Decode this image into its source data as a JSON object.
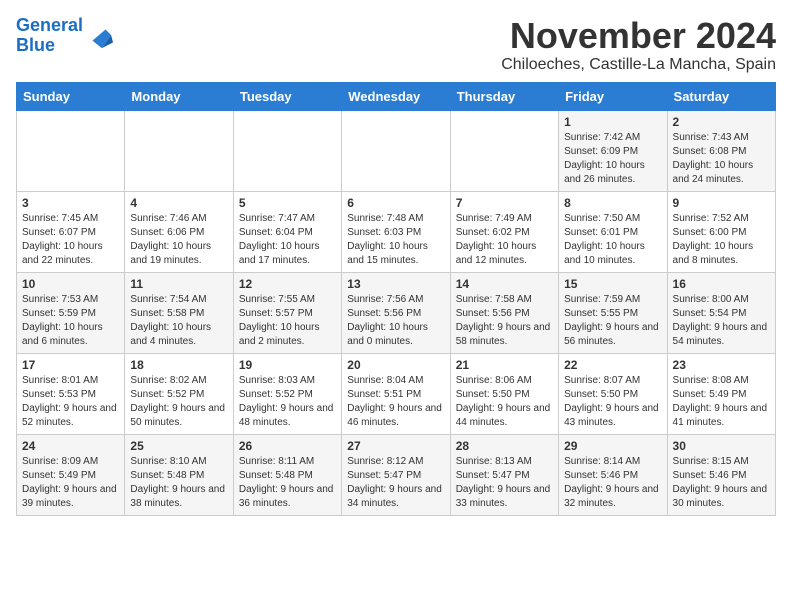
{
  "header": {
    "logo_general": "General",
    "logo_blue": "Blue",
    "month": "November 2024",
    "location": "Chiloeches, Castille-La Mancha, Spain"
  },
  "weekdays": [
    "Sunday",
    "Monday",
    "Tuesday",
    "Wednesday",
    "Thursday",
    "Friday",
    "Saturday"
  ],
  "weeks": [
    [
      {
        "day": "",
        "info": ""
      },
      {
        "day": "",
        "info": ""
      },
      {
        "day": "",
        "info": ""
      },
      {
        "day": "",
        "info": ""
      },
      {
        "day": "",
        "info": ""
      },
      {
        "day": "1",
        "info": "Sunrise: 7:42 AM\nSunset: 6:09 PM\nDaylight: 10 hours and 26 minutes."
      },
      {
        "day": "2",
        "info": "Sunrise: 7:43 AM\nSunset: 6:08 PM\nDaylight: 10 hours and 24 minutes."
      }
    ],
    [
      {
        "day": "3",
        "info": "Sunrise: 7:45 AM\nSunset: 6:07 PM\nDaylight: 10 hours and 22 minutes."
      },
      {
        "day": "4",
        "info": "Sunrise: 7:46 AM\nSunset: 6:06 PM\nDaylight: 10 hours and 19 minutes."
      },
      {
        "day": "5",
        "info": "Sunrise: 7:47 AM\nSunset: 6:04 PM\nDaylight: 10 hours and 17 minutes."
      },
      {
        "day": "6",
        "info": "Sunrise: 7:48 AM\nSunset: 6:03 PM\nDaylight: 10 hours and 15 minutes."
      },
      {
        "day": "7",
        "info": "Sunrise: 7:49 AM\nSunset: 6:02 PM\nDaylight: 10 hours and 12 minutes."
      },
      {
        "day": "8",
        "info": "Sunrise: 7:50 AM\nSunset: 6:01 PM\nDaylight: 10 hours and 10 minutes."
      },
      {
        "day": "9",
        "info": "Sunrise: 7:52 AM\nSunset: 6:00 PM\nDaylight: 10 hours and 8 minutes."
      }
    ],
    [
      {
        "day": "10",
        "info": "Sunrise: 7:53 AM\nSunset: 5:59 PM\nDaylight: 10 hours and 6 minutes."
      },
      {
        "day": "11",
        "info": "Sunrise: 7:54 AM\nSunset: 5:58 PM\nDaylight: 10 hours and 4 minutes."
      },
      {
        "day": "12",
        "info": "Sunrise: 7:55 AM\nSunset: 5:57 PM\nDaylight: 10 hours and 2 minutes."
      },
      {
        "day": "13",
        "info": "Sunrise: 7:56 AM\nSunset: 5:56 PM\nDaylight: 10 hours and 0 minutes."
      },
      {
        "day": "14",
        "info": "Sunrise: 7:58 AM\nSunset: 5:56 PM\nDaylight: 9 hours and 58 minutes."
      },
      {
        "day": "15",
        "info": "Sunrise: 7:59 AM\nSunset: 5:55 PM\nDaylight: 9 hours and 56 minutes."
      },
      {
        "day": "16",
        "info": "Sunrise: 8:00 AM\nSunset: 5:54 PM\nDaylight: 9 hours and 54 minutes."
      }
    ],
    [
      {
        "day": "17",
        "info": "Sunrise: 8:01 AM\nSunset: 5:53 PM\nDaylight: 9 hours and 52 minutes."
      },
      {
        "day": "18",
        "info": "Sunrise: 8:02 AM\nSunset: 5:52 PM\nDaylight: 9 hours and 50 minutes."
      },
      {
        "day": "19",
        "info": "Sunrise: 8:03 AM\nSunset: 5:52 PM\nDaylight: 9 hours and 48 minutes."
      },
      {
        "day": "20",
        "info": "Sunrise: 8:04 AM\nSunset: 5:51 PM\nDaylight: 9 hours and 46 minutes."
      },
      {
        "day": "21",
        "info": "Sunrise: 8:06 AM\nSunset: 5:50 PM\nDaylight: 9 hours and 44 minutes."
      },
      {
        "day": "22",
        "info": "Sunrise: 8:07 AM\nSunset: 5:50 PM\nDaylight: 9 hours and 43 minutes."
      },
      {
        "day": "23",
        "info": "Sunrise: 8:08 AM\nSunset: 5:49 PM\nDaylight: 9 hours and 41 minutes."
      }
    ],
    [
      {
        "day": "24",
        "info": "Sunrise: 8:09 AM\nSunset: 5:49 PM\nDaylight: 9 hours and 39 minutes."
      },
      {
        "day": "25",
        "info": "Sunrise: 8:10 AM\nSunset: 5:48 PM\nDaylight: 9 hours and 38 minutes."
      },
      {
        "day": "26",
        "info": "Sunrise: 8:11 AM\nSunset: 5:48 PM\nDaylight: 9 hours and 36 minutes."
      },
      {
        "day": "27",
        "info": "Sunrise: 8:12 AM\nSunset: 5:47 PM\nDaylight: 9 hours and 34 minutes."
      },
      {
        "day": "28",
        "info": "Sunrise: 8:13 AM\nSunset: 5:47 PM\nDaylight: 9 hours and 33 minutes."
      },
      {
        "day": "29",
        "info": "Sunrise: 8:14 AM\nSunset: 5:46 PM\nDaylight: 9 hours and 32 minutes."
      },
      {
        "day": "30",
        "info": "Sunrise: 8:15 AM\nSunset: 5:46 PM\nDaylight: 9 hours and 30 minutes."
      }
    ]
  ]
}
